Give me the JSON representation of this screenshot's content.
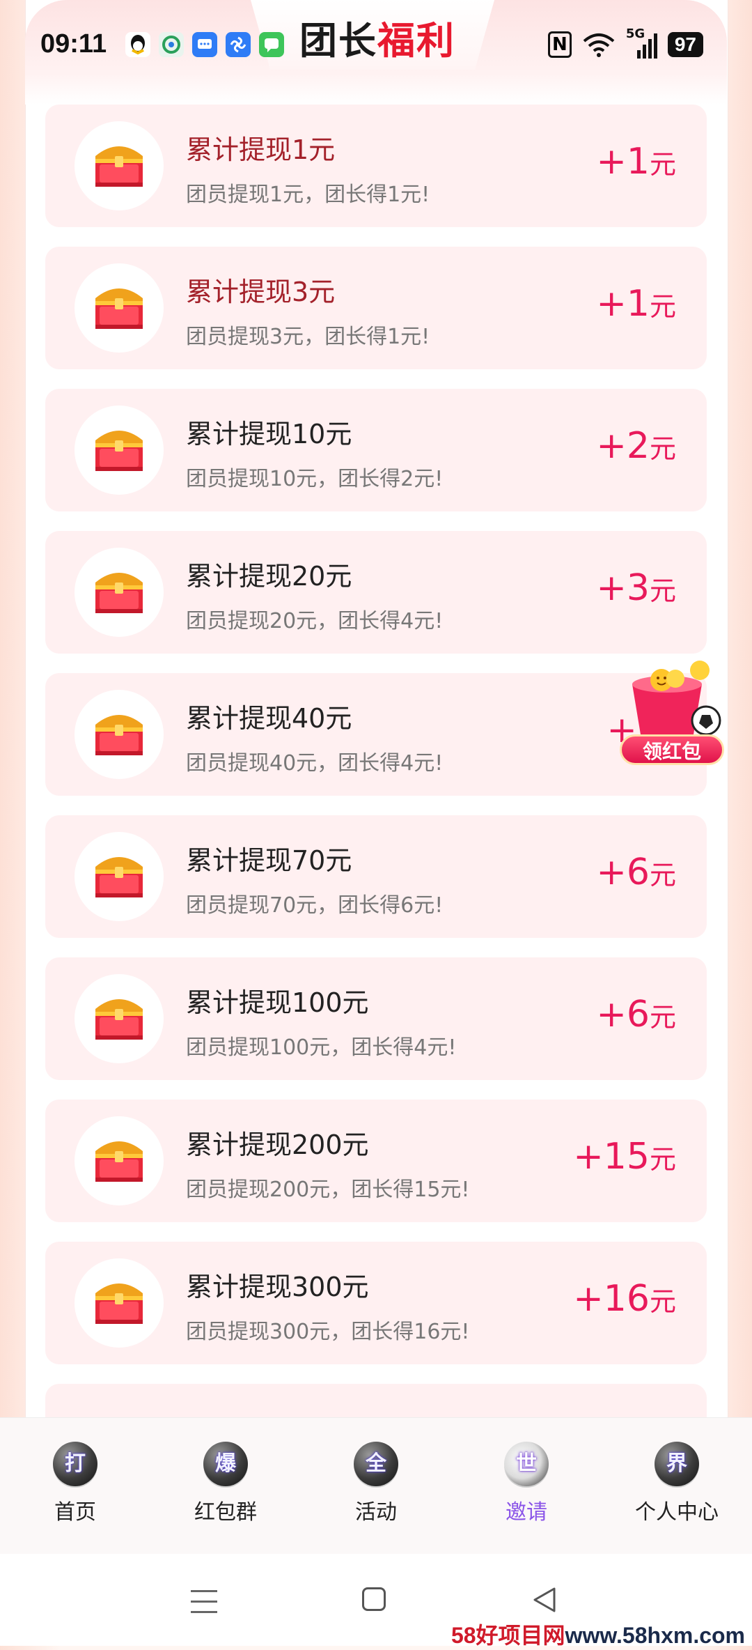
{
  "status_bar": {
    "time": "09:11",
    "battery": "97",
    "network": "5G"
  },
  "header": {
    "title_part1": "团长",
    "title_part2": "福利"
  },
  "rewards": [
    {
      "title": "累计提现1元",
      "desc": "团员提现1元，团长得1元!",
      "amount": "+1",
      "unit": "元",
      "highlight": true
    },
    {
      "title": "累计提现3元",
      "desc": "团员提现3元，团长得1元!",
      "amount": "+1",
      "unit": "元",
      "highlight": true
    },
    {
      "title": "累计提现10元",
      "desc": "团员提现10元，团长得2元!",
      "amount": "+2",
      "unit": "元",
      "highlight": false
    },
    {
      "title": "累计提现20元",
      "desc": "团员提现20元，团长得4元!",
      "amount": "+3",
      "unit": "元",
      "highlight": false
    },
    {
      "title": "累计提现40元",
      "desc": "团员提现40元，团长得4元!",
      "amount": "+",
      "unit": "",
      "highlight": false
    },
    {
      "title": "累计提现70元",
      "desc": "团员提现70元，团长得6元!",
      "amount": "+6",
      "unit": "元",
      "highlight": false
    },
    {
      "title": "累计提现100元",
      "desc": "团员提现100元，团长得4元!",
      "amount": "+6",
      "unit": "元",
      "highlight": false
    },
    {
      "title": "累计提现200元",
      "desc": "团员提现200元，团长得15元!",
      "amount": "+15",
      "unit": "元",
      "highlight": false
    },
    {
      "title": "累计提现300元",
      "desc": "团员提现300元，团长得16元!",
      "amount": "+16",
      "unit": "元",
      "highlight": false
    }
  ],
  "floating_badge": {
    "label": "领红包"
  },
  "tabbar": [
    {
      "glyph": "打",
      "label": "首页"
    },
    {
      "glyph": "爆",
      "label": "红包群"
    },
    {
      "glyph": "全",
      "label": "活动"
    },
    {
      "glyph": "世",
      "label": "邀请"
    },
    {
      "glyph": "界",
      "label": "个人中心"
    }
  ],
  "watermark": {
    "part1": "58好项目网",
    "part2": "www.58hxm.com"
  },
  "colors": {
    "accent": "#e8195a",
    "title_red": "#e8192f",
    "active_tab": "#8b55e8",
    "card_bg": "#fff0f1"
  }
}
